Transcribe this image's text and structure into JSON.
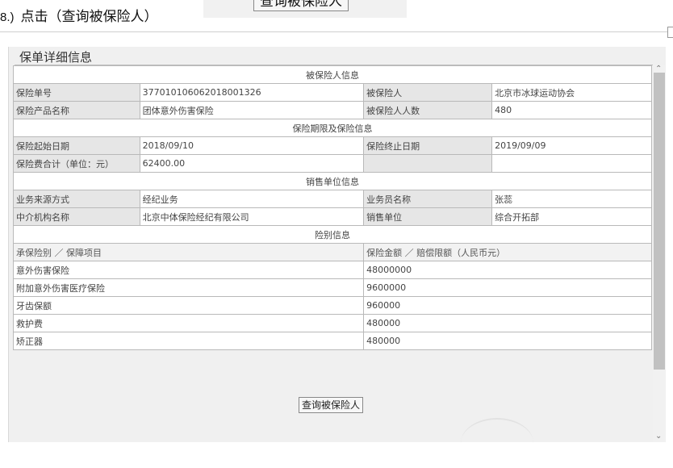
{
  "doc": {
    "step_num": "8.)",
    "step_text": "点击（查询被保险人）",
    "snapshot_button_label": "查询被保险人"
  },
  "panel": {
    "title": "保单详细信息",
    "sections": {
      "insured": "被保险人信息",
      "period": "保险期限及保险信息",
      "sales": "销售单位信息",
      "coverage": "险别信息"
    },
    "policy": {
      "policy_no_label": "保险单号",
      "policy_no": "377010106062018001326",
      "insured_label": "被保险人",
      "insured": "北京市冰球运动协会",
      "product_label": "保险产品名称",
      "product": "团体意外伤害保险",
      "count_label": "被保险人人数",
      "count": "480"
    },
    "period": {
      "start_label": "保险起始日期",
      "start": "2018/09/10",
      "end_label": "保险终止日期",
      "end": "2019/09/09",
      "premium_label": "保险费合计（单位：元）",
      "premium": "62400.00"
    },
    "sales": {
      "source_label": "业务来源方式",
      "source": "经纪业务",
      "agent_label": "业务员名称",
      "agent": "张蕊",
      "broker_label": "中介机构名称",
      "broker": "北京中体保险经纪有限公司",
      "unit_label": "销售单位",
      "unit": "综合开拓部"
    },
    "coverage": {
      "col_item": "承保险别 ／ 保障项目",
      "col_amount": "保险金额 ／ 赔偿限额（人民币元）",
      "rows": [
        {
          "item": "意外伤害保险",
          "amount": "48000000"
        },
        {
          "item": "附加意外伤害医疗保险",
          "amount": "9600000"
        },
        {
          "item": "牙齿保额",
          "amount": "960000"
        },
        {
          "item": "救护费",
          "amount": "480000"
        },
        {
          "item": "矫正器",
          "amount": "480000"
        }
      ]
    },
    "query_button": "查询被保险人"
  }
}
